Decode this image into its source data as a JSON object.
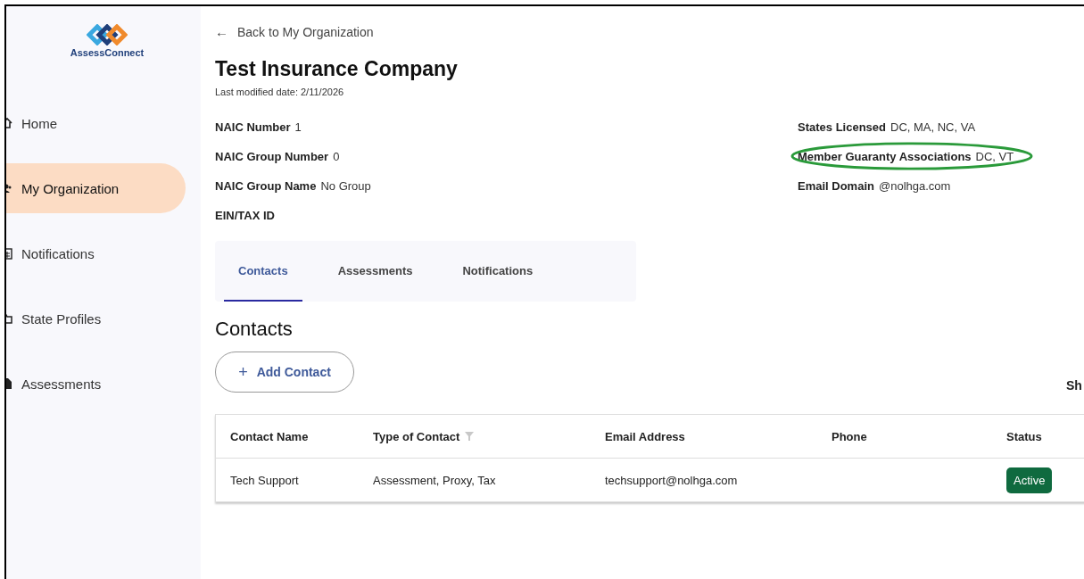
{
  "brand": {
    "name": "AssessConnect"
  },
  "sidebar": {
    "items": [
      {
        "label": "Home",
        "kind": "home",
        "selected": false
      },
      {
        "label": "My Organization",
        "kind": "people",
        "selected": true
      },
      {
        "label": "Notifications",
        "kind": "calendar",
        "selected": false
      },
      {
        "label": "State Profiles",
        "kind": "folder",
        "selected": false
      },
      {
        "label": "Assessments",
        "kind": "file",
        "selected": false
      }
    ]
  },
  "back_arrow": "←",
  "back_link": "Back to My Organization",
  "title": "Test Insurance Company",
  "last_modified": "Last modified date: 2/11/2026",
  "details_left": [
    {
      "label": "NAIC Number",
      "value": "1"
    },
    {
      "label": "NAIC Group Number",
      "value": "0"
    },
    {
      "label": "NAIC Group Name",
      "value": "No Group"
    },
    {
      "label": "EIN/TAX ID"
    }
  ],
  "details_right": [
    {
      "label": "States Licensed",
      "value": "DC, MA, NC, VA",
      "circled": false
    },
    {
      "label": "Member Guaranty Associations",
      "value": "DC, VT",
      "circled": true
    },
    {
      "label": "Email Domain",
      "value": "@nolhga.com",
      "circled": false
    }
  ],
  "tabs": [
    {
      "label": "Contacts",
      "selected": true
    },
    {
      "label": "Assessments",
      "selected": false
    },
    {
      "label": "Notifications",
      "selected": false
    }
  ],
  "section_title": "Contacts",
  "add_icon": "+",
  "add_button": "Add Contact",
  "cut_text": "Sh",
  "table": {
    "columns": [
      {
        "label": "Contact Name",
        "filter": false
      },
      {
        "label": "Type of Contact",
        "filter": true
      },
      {
        "label": "Email Address",
        "filter": false
      },
      {
        "label": "Phone",
        "filter": false
      },
      {
        "label": "Status",
        "filter": false
      }
    ],
    "rows": [
      {
        "name": "Tech Support",
        "type": "Assessment, Proxy, Tax",
        "email": "techsupport@nolhga.com",
        "status": "Active"
      }
    ]
  }
}
